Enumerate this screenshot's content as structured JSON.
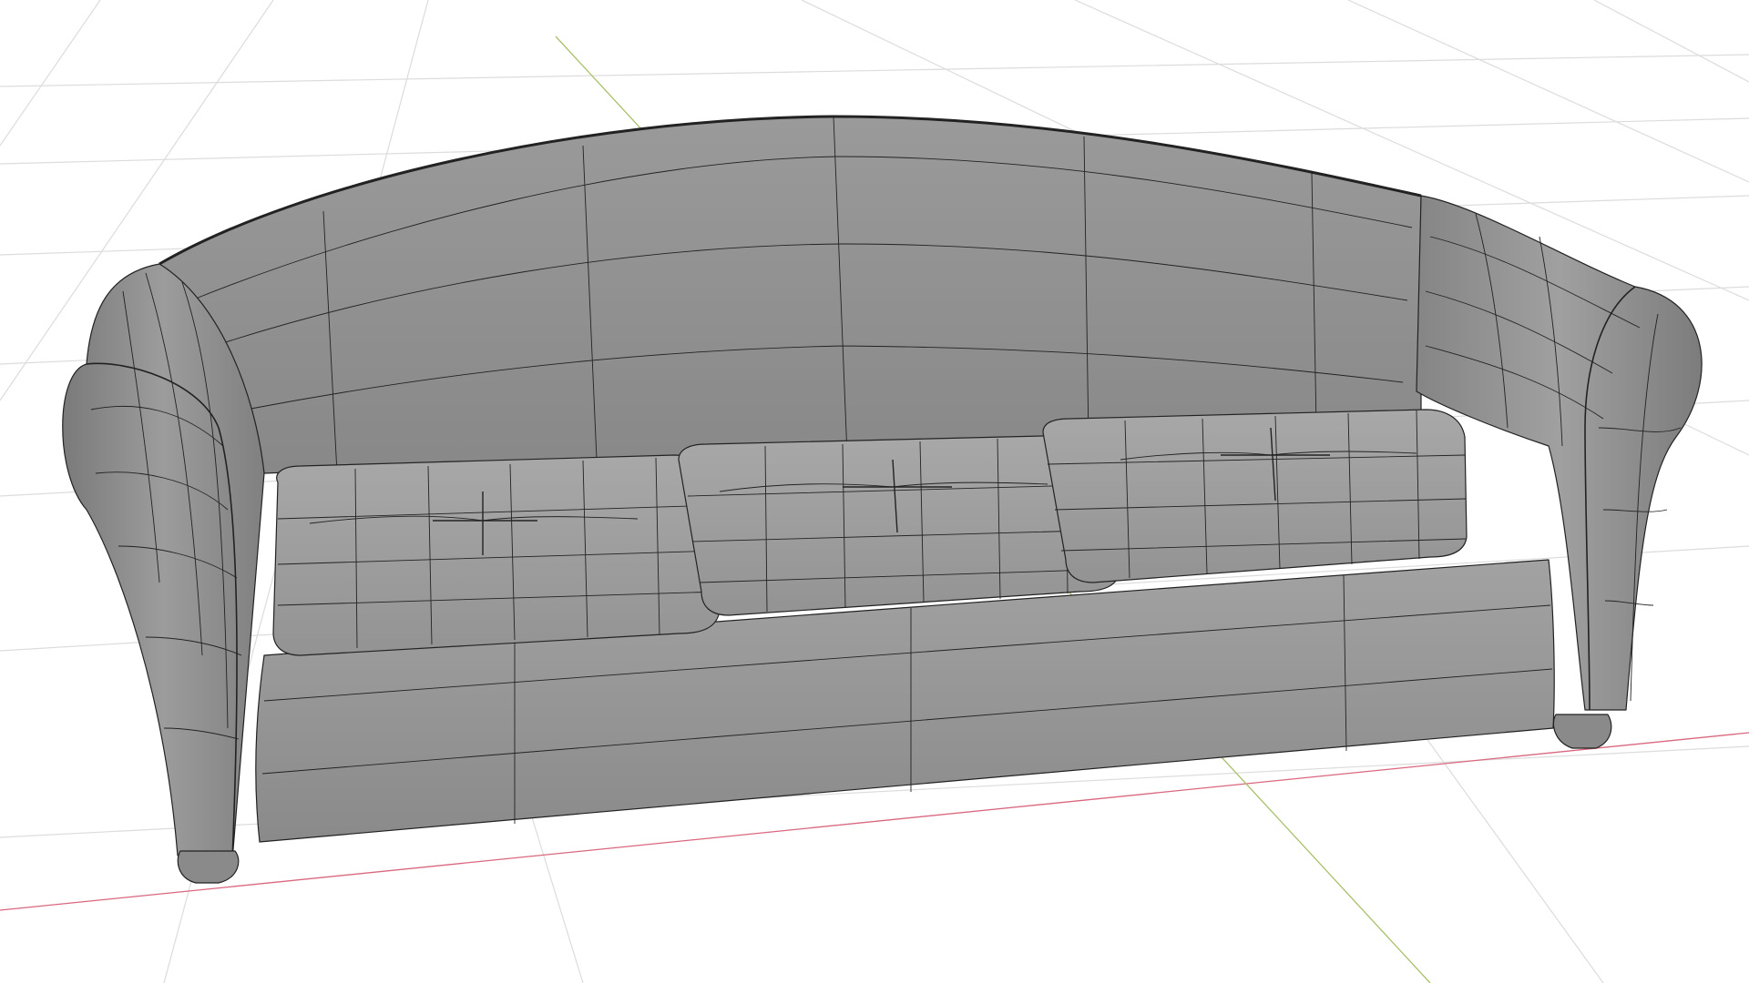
{
  "viewport": {
    "background": "#ffffff",
    "grid_color": "#dcdcdc",
    "x_axis_color": "#d9677e",
    "y_axis_color": "#a7c06a",
    "model": {
      "name": "sofa",
      "shading": "solid",
      "overlay": "wireframe",
      "body_color": "#8e8e8e",
      "light_color": "#a9a9a9",
      "shadow_color": "#6a6a6a",
      "wire_color": "#222222",
      "cushion_count": 3,
      "legs_visible": 2
    }
  }
}
